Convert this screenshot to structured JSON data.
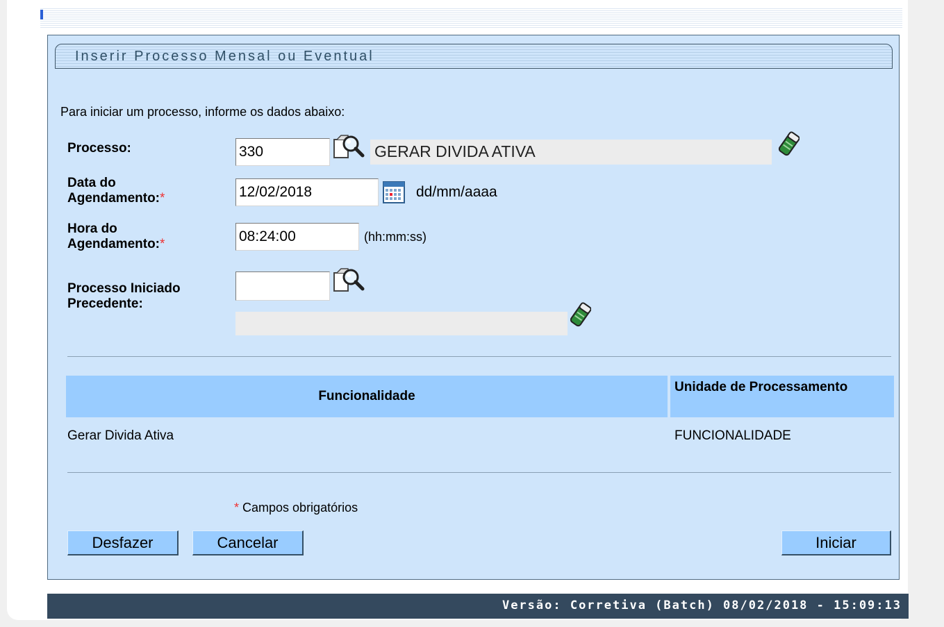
{
  "panel": {
    "title": "Inserir Processo Mensal ou Eventual",
    "intro": "Para iniciar um processo, informe os dados abaixo:"
  },
  "form": {
    "processo_label": "Processo:",
    "processo_code": "330",
    "processo_name": "GERAR DIVIDA ATIVA",
    "data_label_line1": "Data do",
    "data_label_line2": "Agendamento:",
    "data_value": "12/02/2018",
    "data_hint": "dd/mm/aaaa",
    "hora_label_line1": "Hora do",
    "hora_label_line2": "Agendamento:",
    "hora_value": "08:24:00",
    "hora_hint": "(hh:mm:ss)",
    "precedente_label_line1": "Processo Iniciado",
    "precedente_label_line2": "Precedente:",
    "precedente_code": "",
    "precedente_name": "",
    "required_mark": "*"
  },
  "table": {
    "headers": [
      "Funcionalidade",
      "Unidade de Processamento"
    ],
    "rows": [
      [
        "Gerar Divida Ativa",
        "FUNCIONALIDADE"
      ]
    ]
  },
  "required_note": {
    "mark": "*",
    "text": " Campos obrigatórios"
  },
  "buttons": {
    "desfazer": "Desfazer",
    "cancelar": "Cancelar",
    "iniciar": "Iniciar"
  },
  "footer": {
    "version": "Versão: Corretiva (Batch) 08/02/2018 - 15:09:13"
  },
  "colors": {
    "panel_bg": "#cfe5fb",
    "header_bg": "#99ccff",
    "button_bg": "#99ccff",
    "footer_bg": "#34495e",
    "required": "#e33333"
  },
  "icons": {
    "search": "magnifier-search-icon",
    "eraser": "eraser-clear-icon",
    "calendar": "calendar-icon"
  }
}
